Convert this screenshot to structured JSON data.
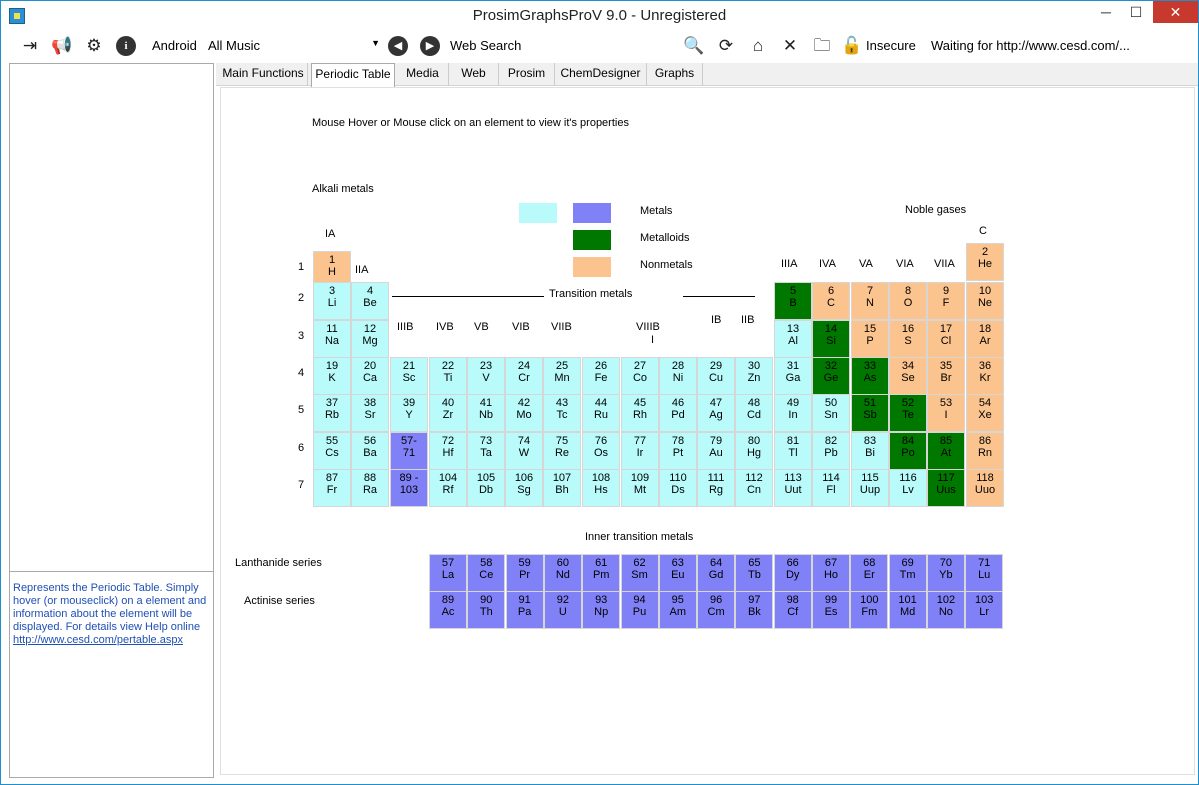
{
  "window": {
    "title": "ProsimGraphsProV 9.0 - Unregistered",
    "min": "─",
    "max": "☐",
    "close": "✕"
  },
  "toolbar": {
    "android_label": "Android",
    "music_value": "All Music",
    "web_search_label": "Web Search",
    "insecure_label": "Insecure",
    "status": "Waiting for http://www.cesd.com/..."
  },
  "tabs": [
    "Main Functions",
    "Periodic Table",
    "Media",
    "Web",
    "Prosim",
    "ChemDesigner",
    "Graphs"
  ],
  "active_tab": "Periodic Table",
  "left_panel": {
    "description": "Represents the Periodic Table. Simply hover (or mouseclick) on a element and information about the element will be displayed. For details view Help online",
    "link": "http://www.cesd.com/pertable.aspx"
  },
  "periodic": {
    "instruction": "Mouse Hover or Mouse click on an element to view it's properties",
    "alkali_label": "Alkali metals",
    "noble_label": "Noble gases",
    "legend": {
      "metals": "Metals",
      "metalloids": "Metalloids",
      "nonmetals": "Nonmetals"
    },
    "transition_label": "Transition metals",
    "inner_label": "Inner transition metals",
    "lanthanide_label": "Lanthanide series",
    "actinide_label": "Actinise series",
    "groups": {
      "IA": "IA",
      "IIA": "IIA",
      "IIIB": "IIIB",
      "IVB": "IVB",
      "VB": "VB",
      "VIB": "VIB",
      "VIIB": "VIIB",
      "VIIIB": "VIIIB",
      "IB": "IB",
      "IIB": "IIB",
      "IIIA": "IIIA",
      "IVA": "IVA",
      "VA": "VA",
      "VIA": "VIA",
      "VIIA": "VIIA",
      "C": "C",
      "I": "I"
    },
    "periods": [
      "1",
      "2",
      "3",
      "4",
      "5",
      "6",
      "7"
    ],
    "elements": [
      {
        "n": "1",
        "s": "H",
        "t": "nm"
      },
      {
        "n": "2",
        "s": "He",
        "t": "nm"
      },
      {
        "n": "3",
        "s": "Li",
        "t": "met"
      },
      {
        "n": "4",
        "s": "Be",
        "t": "met"
      },
      {
        "n": "5",
        "s": "B",
        "t": "mld"
      },
      {
        "n": "6",
        "s": "C",
        "t": "nm"
      },
      {
        "n": "7",
        "s": "N",
        "t": "nm"
      },
      {
        "n": "8",
        "s": "O",
        "t": "nm"
      },
      {
        "n": "9",
        "s": "F",
        "t": "nm"
      },
      {
        "n": "10",
        "s": "Ne",
        "t": "nm"
      },
      {
        "n": "11",
        "s": "Na",
        "t": "met"
      },
      {
        "n": "12",
        "s": "Mg",
        "t": "met"
      },
      {
        "n": "13",
        "s": "Al",
        "t": "met"
      },
      {
        "n": "14",
        "s": "Si",
        "t": "mld"
      },
      {
        "n": "15",
        "s": "P",
        "t": "nm"
      },
      {
        "n": "16",
        "s": "S",
        "t": "nm"
      },
      {
        "n": "17",
        "s": "Cl",
        "t": "nm"
      },
      {
        "n": "18",
        "s": "Ar",
        "t": "nm"
      },
      {
        "n": "19",
        "s": "K",
        "t": "met"
      },
      {
        "n": "20",
        "s": "Ca",
        "t": "met"
      },
      {
        "n": "21",
        "s": "Sc",
        "t": "met"
      },
      {
        "n": "22",
        "s": "Ti",
        "t": "met"
      },
      {
        "n": "23",
        "s": "V",
        "t": "met"
      },
      {
        "n": "24",
        "s": "Cr",
        "t": "met"
      },
      {
        "n": "25",
        "s": "Mn",
        "t": "met"
      },
      {
        "n": "26",
        "s": "Fe",
        "t": "met"
      },
      {
        "n": "27",
        "s": "Co",
        "t": "met"
      },
      {
        "n": "28",
        "s": "Ni",
        "t": "met"
      },
      {
        "n": "29",
        "s": "Cu",
        "t": "met"
      },
      {
        "n": "30",
        "s": "Zn",
        "t": "met"
      },
      {
        "n": "31",
        "s": "Ga",
        "t": "met"
      },
      {
        "n": "32",
        "s": "Ge",
        "t": "mld"
      },
      {
        "n": "33",
        "s": "As",
        "t": "mld"
      },
      {
        "n": "34",
        "s": "Se",
        "t": "nm"
      },
      {
        "n": "35",
        "s": "Br",
        "t": "nm"
      },
      {
        "n": "36",
        "s": "Kr",
        "t": "nm"
      },
      {
        "n": "37",
        "s": "Rb",
        "t": "met"
      },
      {
        "n": "38",
        "s": "Sr",
        "t": "met"
      },
      {
        "n": "39",
        "s": "Y",
        "t": "met"
      },
      {
        "n": "40",
        "s": "Zr",
        "t": "met"
      },
      {
        "n": "41",
        "s": "Nb",
        "t": "met"
      },
      {
        "n": "42",
        "s": "Mo",
        "t": "met"
      },
      {
        "n": "43",
        "s": "Tc",
        "t": "met"
      },
      {
        "n": "44",
        "s": "Ru",
        "t": "met"
      },
      {
        "n": "45",
        "s": "Rh",
        "t": "met"
      },
      {
        "n": "46",
        "s": "Pd",
        "t": "met"
      },
      {
        "n": "47",
        "s": "Ag",
        "t": "met"
      },
      {
        "n": "48",
        "s": "Cd",
        "t": "met"
      },
      {
        "n": "49",
        "s": "In",
        "t": "met"
      },
      {
        "n": "50",
        "s": "Sn",
        "t": "met"
      },
      {
        "n": "51",
        "s": "Sb",
        "t": "mld"
      },
      {
        "n": "52",
        "s": "Te",
        "t": "mld"
      },
      {
        "n": "53",
        "s": "I",
        "t": "nm"
      },
      {
        "n": "54",
        "s": "Xe",
        "t": "nm"
      },
      {
        "n": "55",
        "s": "Cs",
        "t": "met"
      },
      {
        "n": "56",
        "s": "Ba",
        "t": "met"
      },
      {
        "n": "57-",
        "s": "71",
        "t": "cm"
      },
      {
        "n": "72",
        "s": "Hf",
        "t": "met"
      },
      {
        "n": "73",
        "s": "Ta",
        "t": "met"
      },
      {
        "n": "74",
        "s": "W",
        "t": "met"
      },
      {
        "n": "75",
        "s": "Re",
        "t": "met"
      },
      {
        "n": "76",
        "s": "Os",
        "t": "met"
      },
      {
        "n": "77",
        "s": "Ir",
        "t": "met"
      },
      {
        "n": "78",
        "s": "Pt",
        "t": "met"
      },
      {
        "n": "79",
        "s": "Au",
        "t": "met"
      },
      {
        "n": "80",
        "s": "Hg",
        "t": "met"
      },
      {
        "n": "81",
        "s": "Tl",
        "t": "met"
      },
      {
        "n": "82",
        "s": "Pb",
        "t": "met"
      },
      {
        "n": "83",
        "s": "Bi",
        "t": "met"
      },
      {
        "n": "84",
        "s": "Po",
        "t": "mld"
      },
      {
        "n": "85",
        "s": "At",
        "t": "mld"
      },
      {
        "n": "86",
        "s": "Rn",
        "t": "nm"
      },
      {
        "n": "87",
        "s": "Fr",
        "t": "met"
      },
      {
        "n": "88",
        "s": "Ra",
        "t": "met"
      },
      {
        "n": "89 -",
        "s": "103",
        "t": "cm"
      },
      {
        "n": "104",
        "s": "Rf",
        "t": "met"
      },
      {
        "n": "105",
        "s": "Db",
        "t": "met"
      },
      {
        "n": "106",
        "s": "Sg",
        "t": "met"
      },
      {
        "n": "107",
        "s": "Bh",
        "t": "met"
      },
      {
        "n": "108",
        "s": "Hs",
        "t": "met"
      },
      {
        "n": "109",
        "s": "Mt",
        "t": "met"
      },
      {
        "n": "110",
        "s": "Ds",
        "t": "met"
      },
      {
        "n": "111",
        "s": "Rg",
        "t": "met"
      },
      {
        "n": "112",
        "s": "Cn",
        "t": "met"
      },
      {
        "n": "113",
        "s": "Uut",
        "t": "met"
      },
      {
        "n": "114",
        "s": "Fl",
        "t": "met"
      },
      {
        "n": "115",
        "s": "Uup",
        "t": "met"
      },
      {
        "n": "116",
        "s": "Lv",
        "t": "met"
      },
      {
        "n": "117",
        "s": "Uus",
        "t": "mld"
      },
      {
        "n": "118",
        "s": "Uuo",
        "t": "nm"
      }
    ],
    "lanthanides": [
      {
        "n": "57",
        "s": "La"
      },
      {
        "n": "58",
        "s": "Ce"
      },
      {
        "n": "59",
        "s": "Pr"
      },
      {
        "n": "60",
        "s": "Nd"
      },
      {
        "n": "61",
        "s": "Pm"
      },
      {
        "n": "62",
        "s": "Sm"
      },
      {
        "n": "63",
        "s": "Eu"
      },
      {
        "n": "64",
        "s": "Gd"
      },
      {
        "n": "65",
        "s": "Tb"
      },
      {
        "n": "66",
        "s": "Dy"
      },
      {
        "n": "67",
        "s": "Ho"
      },
      {
        "n": "68",
        "s": "Er"
      },
      {
        "n": "69",
        "s": "Tm"
      },
      {
        "n": "70",
        "s": "Yb"
      },
      {
        "n": "71",
        "s": "Lu"
      }
    ],
    "actinides": [
      {
        "n": "89",
        "s": "Ac"
      },
      {
        "n": "90",
        "s": "Th"
      },
      {
        "n": "91",
        "s": "Pa"
      },
      {
        "n": "92",
        "s": "U"
      },
      {
        "n": "93",
        "s": "Np"
      },
      {
        "n": "94",
        "s": "Pu"
      },
      {
        "n": "95",
        "s": "Am"
      },
      {
        "n": "96",
        "s": "Cm"
      },
      {
        "n": "97",
        "s": "Bk"
      },
      {
        "n": "98",
        "s": "Cf"
      },
      {
        "n": "99",
        "s": "Es"
      },
      {
        "n": "100",
        "s": "Fm"
      },
      {
        "n": "101",
        "s": "Md"
      },
      {
        "n": "102",
        "s": "No"
      },
      {
        "n": "103",
        "s": "Lr"
      }
    ],
    "colors": {
      "met": "#b9fbfb",
      "cm": "#8181f7",
      "mld": "#007800",
      "nm": "#fbc38e"
    }
  }
}
